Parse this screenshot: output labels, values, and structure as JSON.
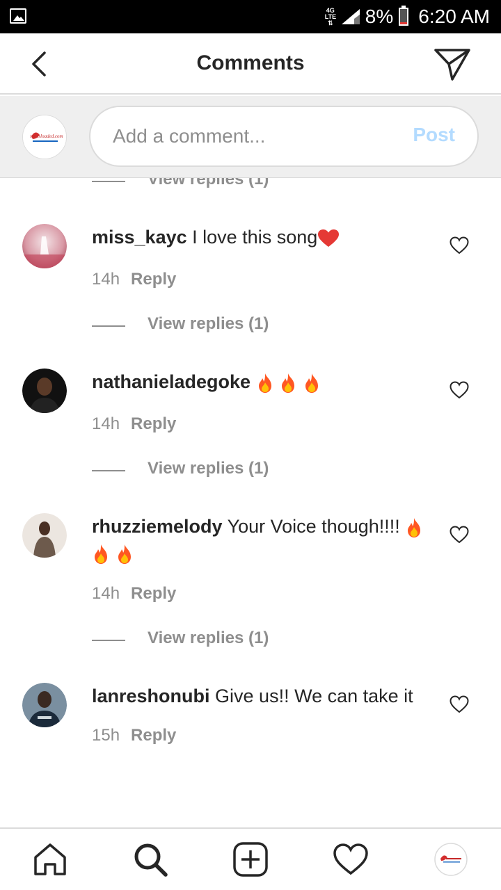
{
  "status_bar": {
    "network": "4G LTE",
    "battery": "8%",
    "time": "6:20 AM"
  },
  "header": {
    "title": "Comments"
  },
  "composer": {
    "placeholder": "Add a comment...",
    "post_label": "Post",
    "avatar_text": "tunesloaded.com"
  },
  "previous_replies_label": "View replies (1)",
  "comments": [
    {
      "username": "miss_kayc",
      "text": "I love this song",
      "emoji": "heart",
      "time": "14h",
      "reply_label": "Reply",
      "view_replies": "View replies (1)"
    },
    {
      "username": "nathanieladegoke",
      "text": "",
      "emoji": "fire x3",
      "time": "14h",
      "reply_label": "Reply",
      "view_replies": "View replies (1)"
    },
    {
      "username": "rhuzziemelody",
      "text": "Your Voice though!!!!",
      "emoji": "fire x3",
      "time": "14h",
      "reply_label": "Reply",
      "view_replies": "View replies (1)"
    },
    {
      "username": "lanreshonubi",
      "text": "Give us!! We can take it",
      "emoji": "",
      "time": "15h",
      "reply_label": "Reply"
    }
  ],
  "colors": {
    "post_disabled": "#b3dbff",
    "secondary_text": "#8e8e8e",
    "divider": "#dbdbdb",
    "composer_bg": "#efefef"
  },
  "icons": [
    "back-arrow-icon",
    "send-icon",
    "heart-outline-icon",
    "home-icon",
    "search-icon",
    "add-post-icon",
    "activity-heart-icon",
    "profile-avatar-icon"
  ]
}
